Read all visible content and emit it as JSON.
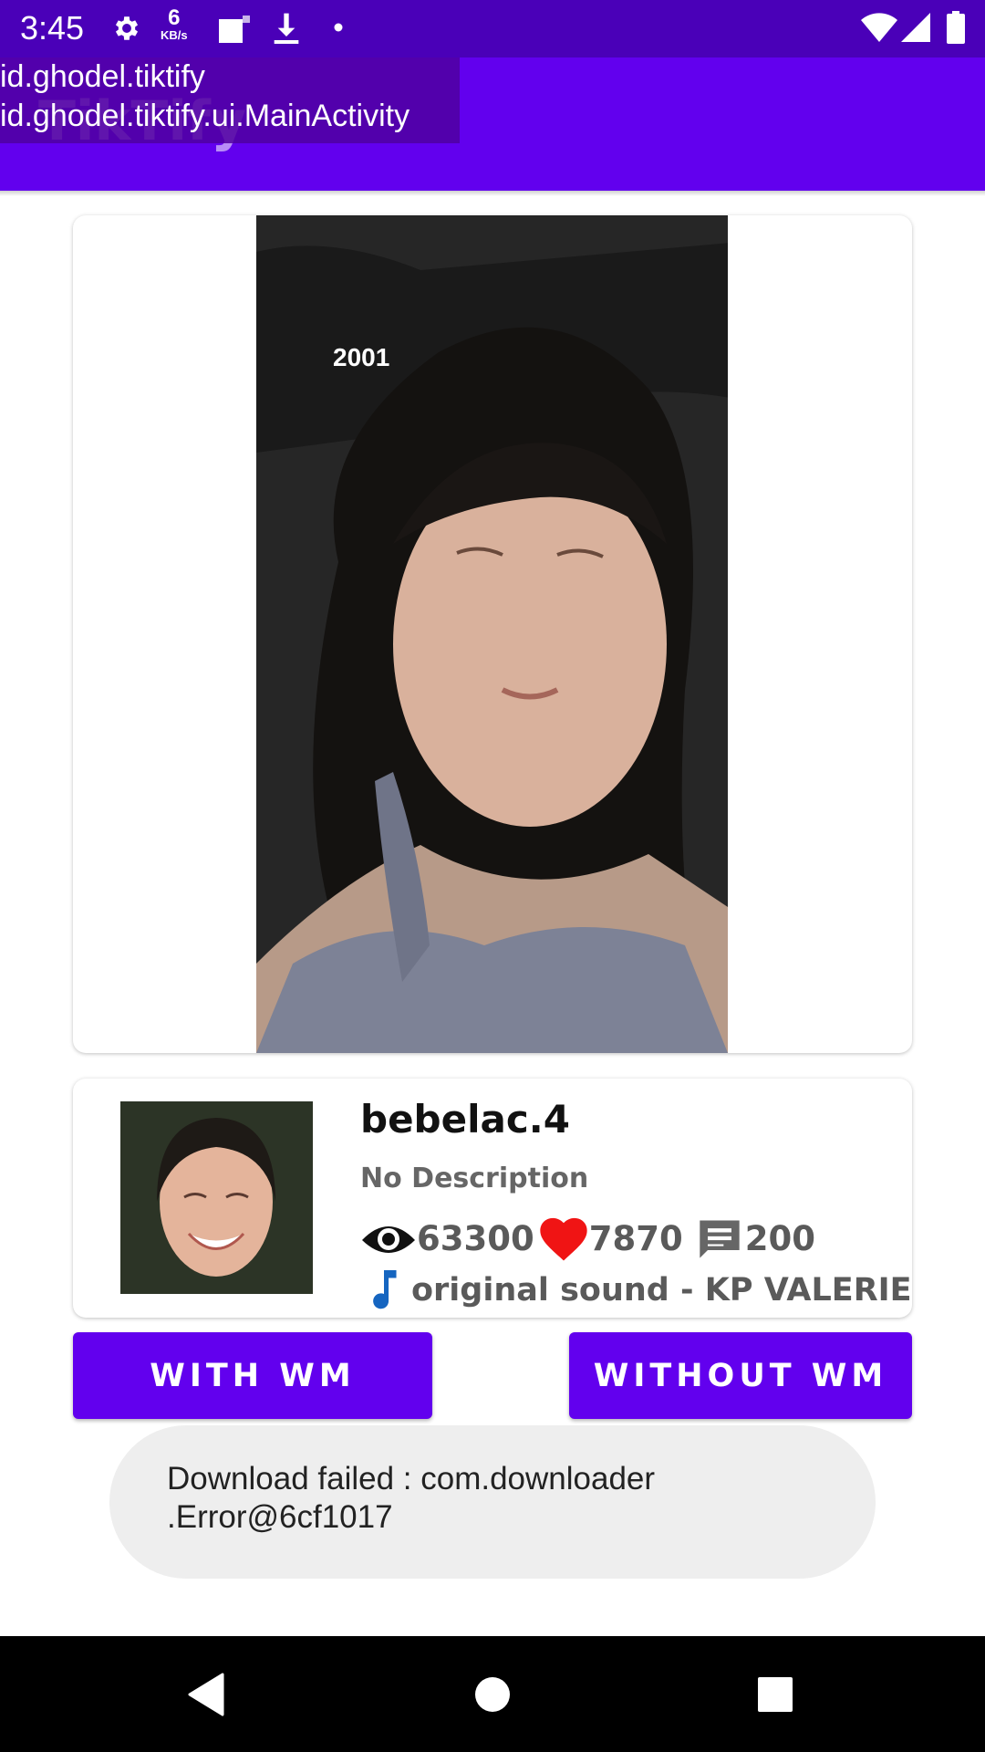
{
  "status_bar": {
    "time": "3:45",
    "net_speed_value": "6",
    "net_speed_unit": "KB/s",
    "icons": [
      "gear-icon",
      "net-speed",
      "sim-icon",
      "download-icon",
      "dot-icon",
      "wifi-icon",
      "signal-icon",
      "battery-icon"
    ]
  },
  "app_bar": {
    "title": "TikTify",
    "color": "#6200ee"
  },
  "debug_overlay": {
    "package": "id.ghodel.tiktify",
    "activity": "id.ghodel.tiktify.ui.MainActivity"
  },
  "video": {
    "caption": "2001"
  },
  "profile": {
    "username": "bebelac.4",
    "description": "No Description",
    "views": "63300",
    "likes": "7870",
    "comments": "200",
    "sound": "original sound - KP VALERIE"
  },
  "buttons": {
    "with_wm": "WITH WM",
    "without_wm": "WITHOUT WM"
  },
  "toast": {
    "line1": "Download failed : com.downloader",
    "line2": ".Error@6cf1017"
  },
  "colors": {
    "status_bar": "#4a00b8",
    "accent": "#6200ee",
    "like": "#f01414",
    "music": "#1565c0"
  }
}
